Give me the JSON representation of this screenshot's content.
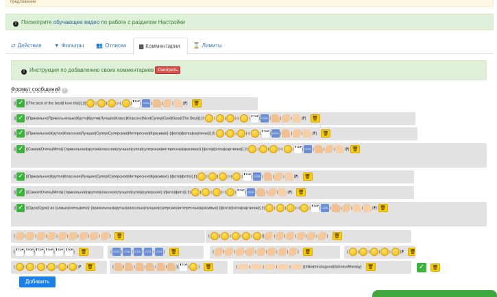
{
  "top_warning": "предложений",
  "info": {
    "prefix": "Посмотрите ",
    "link": "обучающее видео",
    "suffix": " по работе с разделом Настройки"
  },
  "tabs": [
    "Действия",
    "Фильтры",
    "Отписка",
    "Комментарии",
    "Лимиты"
  ],
  "instruction": {
    "text": "Инструкция по добавлению своих комментариев",
    "button": "Смотреть"
  },
  "format_label": "Формат сообщений",
  "rows": [
    "{The best of the best|I love this}{.|!|",
    "{Прикольно|Прикольненько|Круто|Крутяк|Лучшее|Класс|Классно|Nice|Супер|Cool|Good|The Best}{.|!|",
    "{Прикольная|Крутая|Классная|Лучшая|Супер|Суперская|Интересная|Красивая} {фота|фотка|картинка}{.|!|",
    "{Самая|Очень|Мега} {прикольная|крутая|классная|лучшая|супер|суперская|интересная|красивая} {фота|фотка|картинка}{.|!|",
    "{Прикольное|Крутое|Классное|Лучшее|Супер|Суперское|Интересное|Красивое} {фото|фото}{.|!|",
    "{Самое|Очень|Мега} {прикольное|крутое|классное|лучшее|супер|суперское} {фото|фото}{.|!|",
    "{Одна|Одно} из {самых|очень|мега} {прикольных|крутых|классных|лучших|суперских|интересных|красивых} {фото|фоток|картинок}{.|!|"
  ],
  "hashtags": "{#like|#instagood|#photooftheday}",
  "add_button": "Добавить"
}
